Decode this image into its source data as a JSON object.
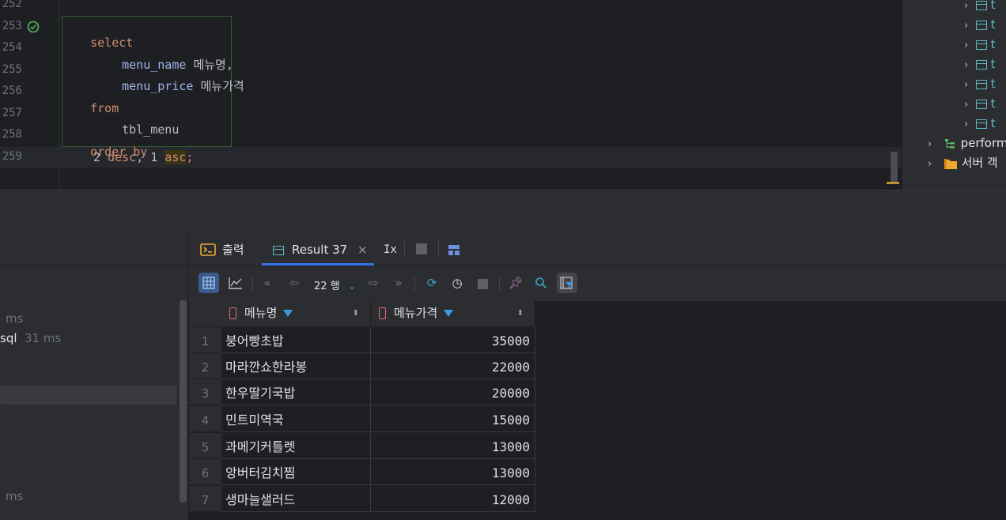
{
  "editor": {
    "line_numbers": [
      "252",
      "253",
      "254",
      "255",
      "256",
      "257",
      "258",
      "259"
    ],
    "code": {
      "l253": "select",
      "l254_col": "menu_name",
      "l254_alias": "메뉴명,",
      "l255_col": "menu_price",
      "l255_alias": "메뉴가격",
      "l256": "from",
      "l257": "tbl_menu",
      "l258": "order by",
      "l259_a": "2 ",
      "l259_desc": "desc",
      "l259_b": ", 1 ",
      "l259_asc": "asc",
      "l259_semi": ";"
    }
  },
  "tree": {
    "table_label_fragment": "t",
    "items": [
      "perform",
      "서버 객"
    ]
  },
  "services": {
    "ms_1": "ms",
    "sql_label": "sql",
    "sql_time": "31 ms",
    "ms_2": "ms"
  },
  "result": {
    "tabs": {
      "output": "출력",
      "result": "Result 37",
      "close": "×",
      "tx": "Ix"
    },
    "toolbar": {
      "rows_label": "22 행"
    },
    "columns": [
      "메뉴명",
      "메뉴가격"
    ],
    "rows": [
      {
        "num": "1",
        "name": "붕어빵초밥",
        "price": "35000"
      },
      {
        "num": "2",
        "name": "마라깐쇼한라봉",
        "price": "22000"
      },
      {
        "num": "3",
        "name": "한우딸기국밥",
        "price": "20000"
      },
      {
        "num": "4",
        "name": "민트미역국",
        "price": "15000"
      },
      {
        "num": "5",
        "name": "과메기커틀렛",
        "price": "13000"
      },
      {
        "num": "6",
        "name": "앙버터김치찜",
        "price": "13000"
      },
      {
        "num": "7",
        "name": "생마늘샐러드",
        "price": "12000"
      }
    ]
  },
  "colors": {
    "keyword": "#cf8e6d",
    "column": "#c77dbb",
    "accent": "#3574f0",
    "filter": "#3b9ae0"
  }
}
